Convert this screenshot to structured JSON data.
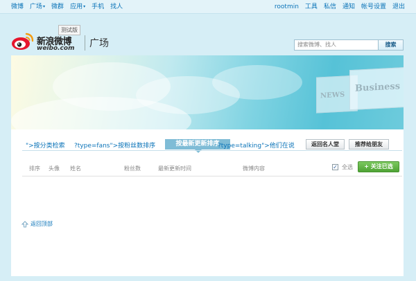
{
  "topnav": {
    "left": [
      {
        "label": "微博",
        "caret": false
      },
      {
        "label": "广场",
        "caret": true
      },
      {
        "label": "微群",
        "caret": false
      },
      {
        "label": "应用",
        "caret": true
      },
      {
        "label": "手机",
        "caret": false
      },
      {
        "label": "找人",
        "caret": false
      }
    ],
    "right": {
      "user": "rootmin",
      "items": [
        "工具",
        "私信",
        "通知",
        "帐号设置",
        "退出"
      ]
    },
    "caret_glyph": "▾"
  },
  "logo": {
    "cn": "新浪微博",
    "en": "weibo.com",
    "beta": "测试版",
    "section": "广场"
  },
  "search": {
    "placeholder": "搜索微博、找人",
    "button": "搜索"
  },
  "banner": {
    "news_text": "NEWS",
    "business_text": "Business"
  },
  "tabs": {
    "category": "\">按分类检索",
    "fans": "?type=fans\">按粉丝数排序",
    "active": "按最新更新排序",
    "talking": "?type=talking\">他们在说",
    "hall_button": "返回名人堂",
    "recommend_button": "推荐给朋友"
  },
  "table": {
    "headers": [
      "排序",
      "头像",
      "姓名",
      "粉丝数",
      "最新更新时间",
      "微博内容"
    ],
    "select_all": "全选",
    "follow_button": "关注已选",
    "follow_glyph": "+",
    "check_glyph": "✓"
  },
  "back_to_top": "返回顶部",
  "colors": {
    "link": "#0a73b8",
    "active_tab": "#7fbcd6",
    "follow_green": "#4ea334",
    "page_bg": "#d6eef6"
  }
}
